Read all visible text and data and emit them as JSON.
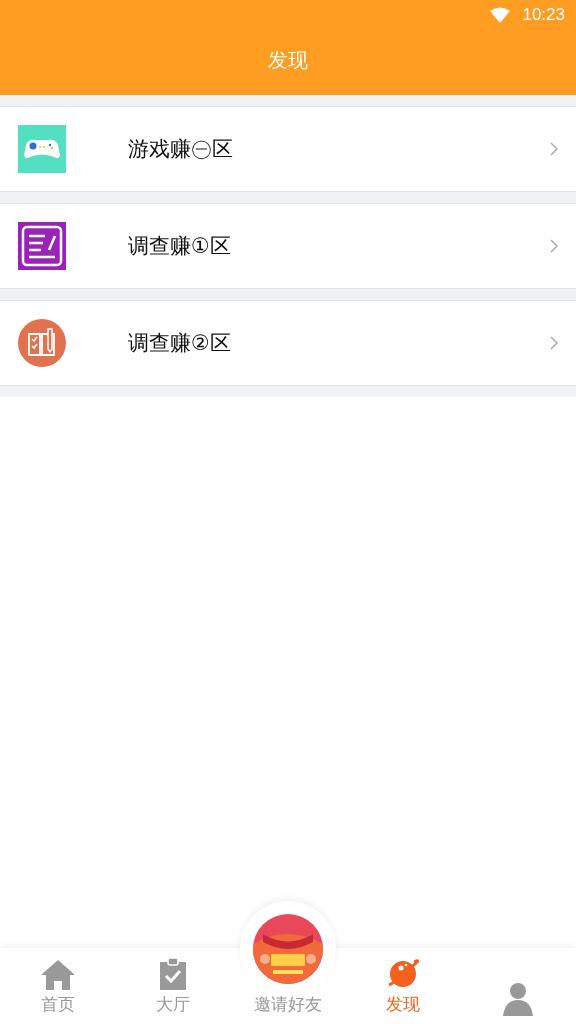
{
  "status_bar": {
    "time": "10:23"
  },
  "header": {
    "title": "发现"
  },
  "items": [
    {
      "label": "游戏赚㊀区",
      "kind": "game"
    },
    {
      "label": "调查赚①区",
      "kind": "survey"
    },
    {
      "label": "调查赚②区",
      "kind": "book"
    }
  ],
  "tab_bar": [
    {
      "label": "首页",
      "kind": "home",
      "selected": false
    },
    {
      "label": "大厅",
      "kind": "clipboard",
      "selected": false
    },
    {
      "label": "邀请好友",
      "kind": "invite",
      "selected": false
    },
    {
      "label": "发现",
      "kind": "planet",
      "selected": true
    },
    {
      "kind": "person",
      "selected": false
    }
  ]
}
